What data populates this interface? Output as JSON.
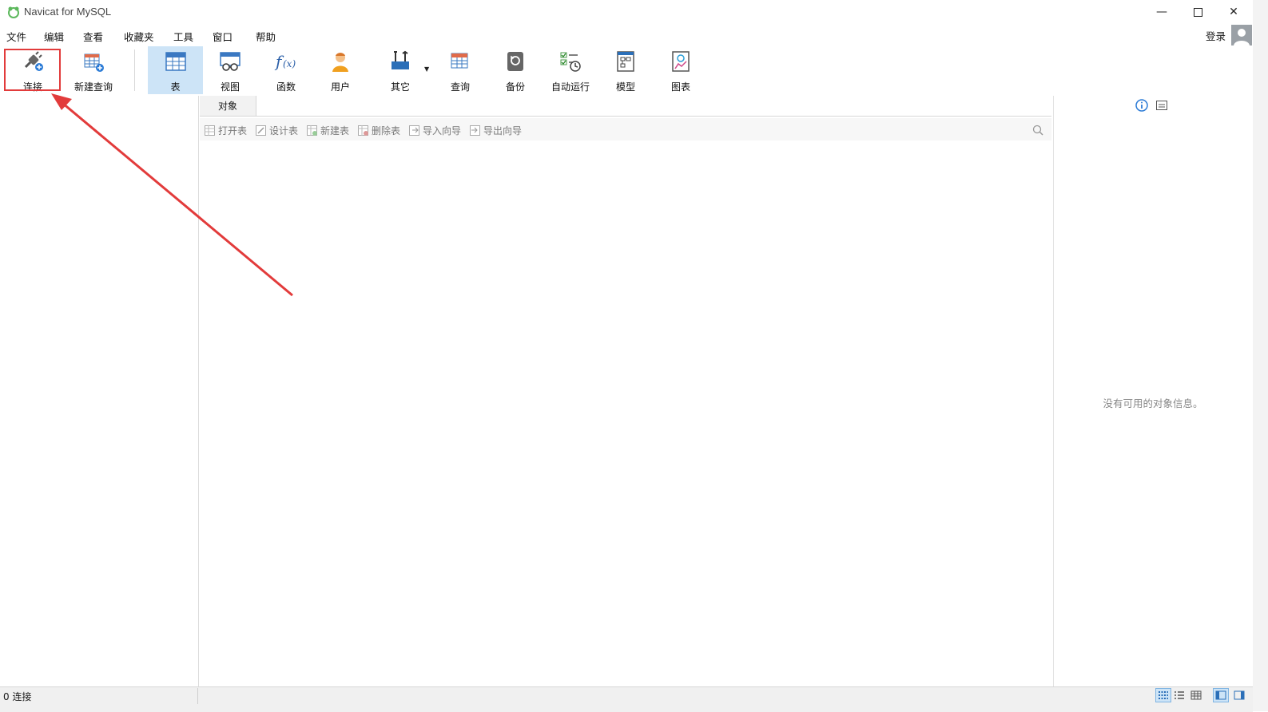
{
  "app": {
    "title": "Navicat for MySQL"
  },
  "menu": [
    "文件",
    "编辑",
    "查看",
    "收藏夹",
    "工具",
    "窗口",
    "帮助"
  ],
  "login_label": "登录",
  "toolbar": {
    "connect": "连接",
    "new_query": "新建查询",
    "table": "表",
    "view": "视图",
    "function": "函数",
    "user": "用户",
    "other": "其它",
    "query": "查询",
    "backup": "备份",
    "auto_run": "自动运行",
    "model": "模型",
    "chart": "图表"
  },
  "tabs": {
    "objects": "对象"
  },
  "subtoolbar": {
    "open_table": "打开表",
    "design_table": "设计表",
    "new_table": "新建表",
    "delete_table": "删除表",
    "import_wizard": "导入向导",
    "export_wizard": "导出向导"
  },
  "right_pane": {
    "no_info": "没有可用的对象信息。"
  },
  "status": {
    "connections": "0 连接"
  },
  "colors": {
    "accent": "#cde4f7",
    "annotation": "#e23b3b",
    "brand_green": "#5cb85c"
  }
}
